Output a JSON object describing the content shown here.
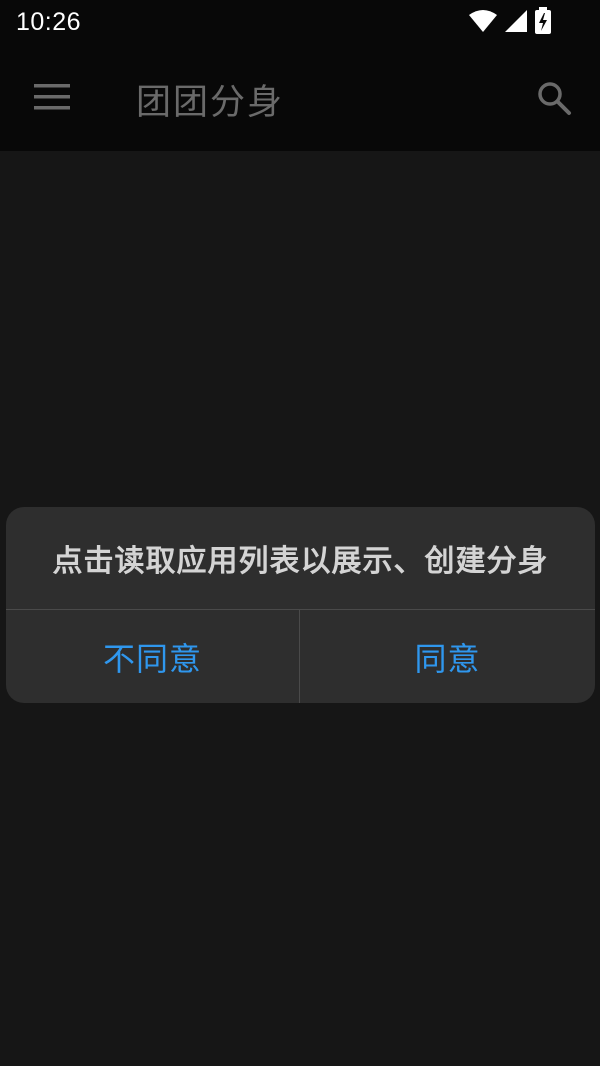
{
  "status_bar": {
    "time": "10:26",
    "icons": [
      "wifi-icon",
      "cellular-signal-icon",
      "battery-charging-icon"
    ]
  },
  "app_bar": {
    "title": "团团分身",
    "left_icon": "menu-icon",
    "right_icon": "search-icon"
  },
  "dialog": {
    "message": "点击读取应用列表以展示、创建分身",
    "disagree_label": "不同意",
    "agree_label": "同意"
  },
  "colors": {
    "background": "#161616",
    "app_bar": "#080808",
    "dialog": "#2e2e2e",
    "accent": "#2f97ee",
    "title_text": "#6a6a6a"
  }
}
